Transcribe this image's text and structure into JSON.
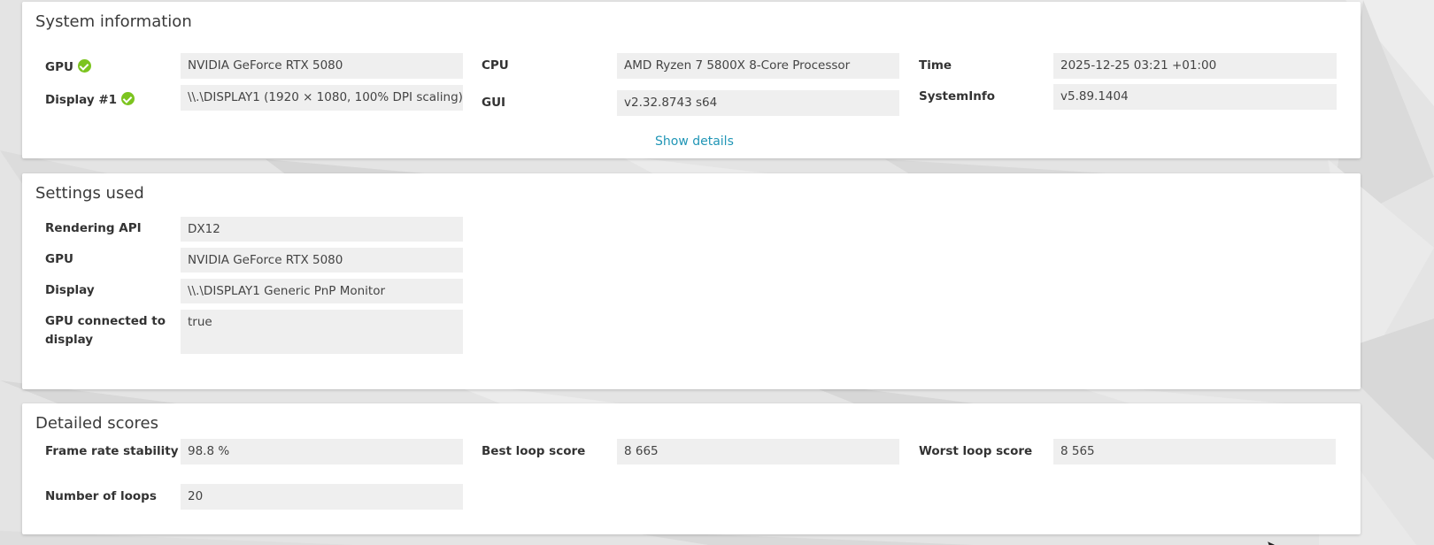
{
  "system_information": {
    "title": "System information",
    "gpu_label": "GPU",
    "gpu_value": "NVIDIA GeForce RTX 5080",
    "display_label": "Display #1",
    "display_value": "\\\\.\\DISPLAY1 (1920 × 1080, 100% DPI scaling)",
    "cpu_label": "CPU",
    "cpu_value": "AMD Ryzen 7 5800X 8-Core Processor",
    "gui_label": "GUI",
    "gui_value": "v2.32.8743 s64",
    "time_label": "Time",
    "time_value": "2025-12-25 03:21 +01:00",
    "systeminfo_label": "SystemInfo",
    "systeminfo_value": "v5.89.1404",
    "show_details": "Show details"
  },
  "settings_used": {
    "title": "Settings used",
    "rendering_api_label": "Rendering API",
    "rendering_api_value": "DX12",
    "gpu_label": "GPU",
    "gpu_value": "NVIDIA GeForce RTX 5080",
    "display_label": "Display",
    "display_value": "\\\\.\\DISPLAY1 Generic PnP Monitor",
    "gpu_connected_label": "GPU connected to display",
    "gpu_connected_value": "true"
  },
  "detailed_scores": {
    "title": "Detailed scores",
    "frame_rate_stability_label": "Frame rate stability",
    "frame_rate_stability_value": "98.8 %",
    "best_loop_label": "Best loop score",
    "best_loop_value": "8 665",
    "worst_loop_label": "Worst loop score",
    "worst_loop_value": "8 565",
    "number_of_loops_label": "Number of loops",
    "number_of_loops_value": "20"
  },
  "icons": {
    "status": "check-circle-icon",
    "status_color": "#7cc41f",
    "link_color": "#2196b6"
  }
}
